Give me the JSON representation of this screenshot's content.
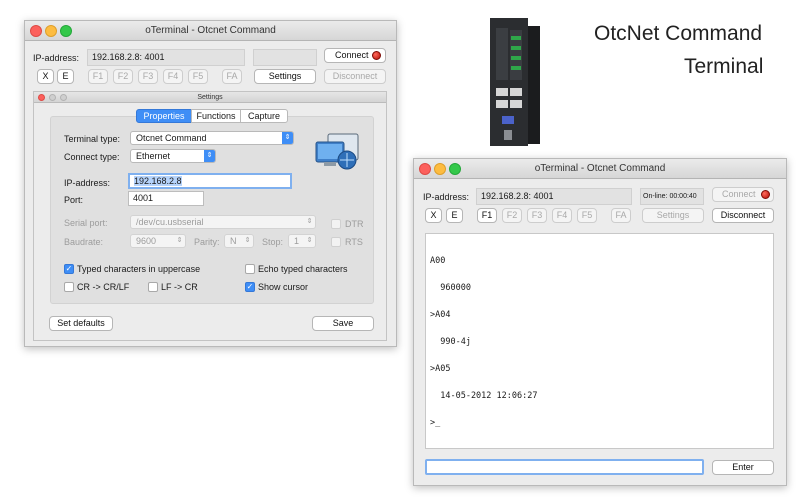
{
  "headline": {
    "line1": "OtcNet Command",
    "line2": "Terminal"
  },
  "win1": {
    "title": "oTerminal - Otcnet Command",
    "ip_label": "IP-address:",
    "ip_value": "192.168.2.8: 4001",
    "connect": "Connect",
    "x_label": "X",
    "e_label": "E",
    "fkeys": [
      "F1",
      "F2",
      "F3",
      "F4",
      "F5",
      "FA"
    ],
    "settings": "Settings",
    "disconnect": "Disconnect"
  },
  "settings": {
    "title": "Settings",
    "tabs": [
      "Properties",
      "Functions",
      "Capture"
    ],
    "terminal_type_label": "Terminal type:",
    "terminal_type_value": "Otcnet  Command",
    "connect_type_label": "Connect type:",
    "connect_type_value": "Ethernet",
    "ip_label": "IP-address:",
    "ip_value": "192.168.2.8",
    "port_label": "Port:",
    "port_value": "4001",
    "serial_label": "Serial port:",
    "serial_value": "/dev/cu.usbserial",
    "dtr": "DTR",
    "baud_label": "Baudrate:",
    "baud_value": "9600",
    "parity_label": "Parity:",
    "parity_value": "N",
    "stop_label": "Stop:",
    "stop_value": "1",
    "rts": "RTS",
    "upper": "Typed characters in uppercase",
    "echo": "Echo typed characters",
    "crlf": "CR -> CR/LF",
    "lfcr": "LF -> CR",
    "cursor": "Show cursor",
    "set_defaults": "Set defaults",
    "save": "Save"
  },
  "win2": {
    "title": "oTerminal - Otcnet  Command",
    "ip_label": "IP-address:",
    "ip_value": "192.168.2.8: 4001",
    "online": "On-line: 00:00:40",
    "connect": "Connect",
    "x_label": "X",
    "e_label": "E",
    "fkeys": [
      "F1",
      "F2",
      "F3",
      "F4",
      "F5",
      "FA"
    ],
    "settings": "Settings",
    "disconnect": "Disconnect",
    "terminal_lines": [
      "A00",
      "  960000",
      ">A04",
      "  990-4j",
      ">A05",
      "  14-05-2012 12:06:27",
      ">_"
    ],
    "enter": "Enter"
  },
  "colors": {
    "accent": "#3f8ef6",
    "led": "#d01a10"
  }
}
